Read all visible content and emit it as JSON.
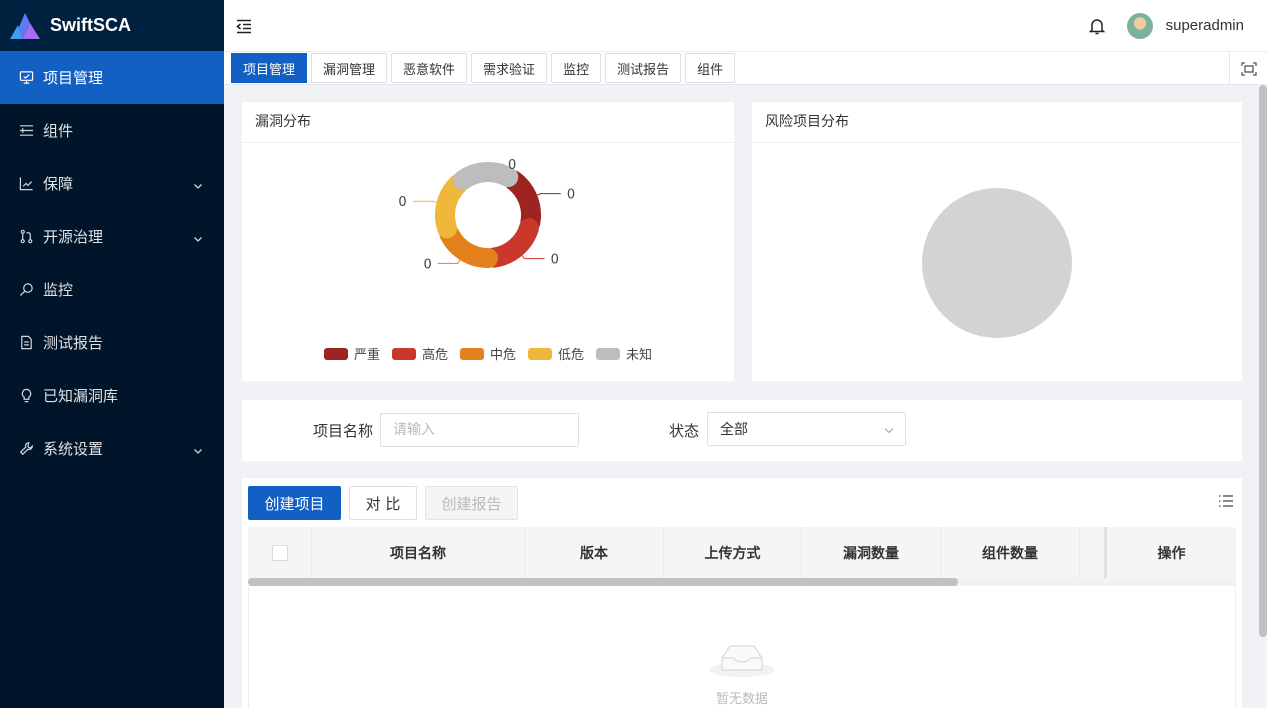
{
  "app": {
    "name": "SwiftSCA"
  },
  "sidebar": {
    "items": [
      {
        "label": "项目管理",
        "icon": "monitor-icon"
      },
      {
        "label": "组件",
        "icon": "list-icon"
      },
      {
        "label": "保障",
        "icon": "chart-icon",
        "expandable": true
      },
      {
        "label": "开源治理",
        "icon": "branch-icon",
        "expandable": true
      },
      {
        "label": "监控",
        "icon": "search-icon"
      },
      {
        "label": "测试报告",
        "icon": "file-icon"
      },
      {
        "label": "已知漏洞库",
        "icon": "bulb-icon"
      },
      {
        "label": "系统设置",
        "icon": "wrench-icon",
        "expandable": true
      }
    ]
  },
  "header": {
    "username": "superadmin"
  },
  "tabs": [
    "项目管理",
    "漏洞管理",
    "恶意软件",
    "需求验证",
    "监控",
    "测试报告",
    "组件"
  ],
  "cards": {
    "vuln_title": "漏洞分布",
    "risk_title": "风险项目分布"
  },
  "chart_data": [
    {
      "type": "pie",
      "title": "漏洞分布",
      "categories": [
        "严重",
        "高危",
        "中危",
        "低危",
        "未知"
      ],
      "values": [
        0,
        0,
        0,
        0,
        0
      ],
      "colors": [
        "#9e2422",
        "#c9382a",
        "#e3821d",
        "#f0b83a",
        "#bdbdbd"
      ],
      "legend": "bottom"
    },
    {
      "type": "pie",
      "title": "风险项目分布",
      "categories": [],
      "values": []
    }
  ],
  "filter": {
    "name_label": "项目名称",
    "name_placeholder": "请输入",
    "status_label": "状态",
    "status_value": "全部"
  },
  "toolbar": {
    "create": "创建项目",
    "compare": "对 比",
    "report": "创建报告"
  },
  "table": {
    "columns": [
      "项目名称",
      "版本",
      "上传方式",
      "漏洞数量",
      "组件数量",
      "操作"
    ],
    "empty_text": "暂无数据"
  }
}
